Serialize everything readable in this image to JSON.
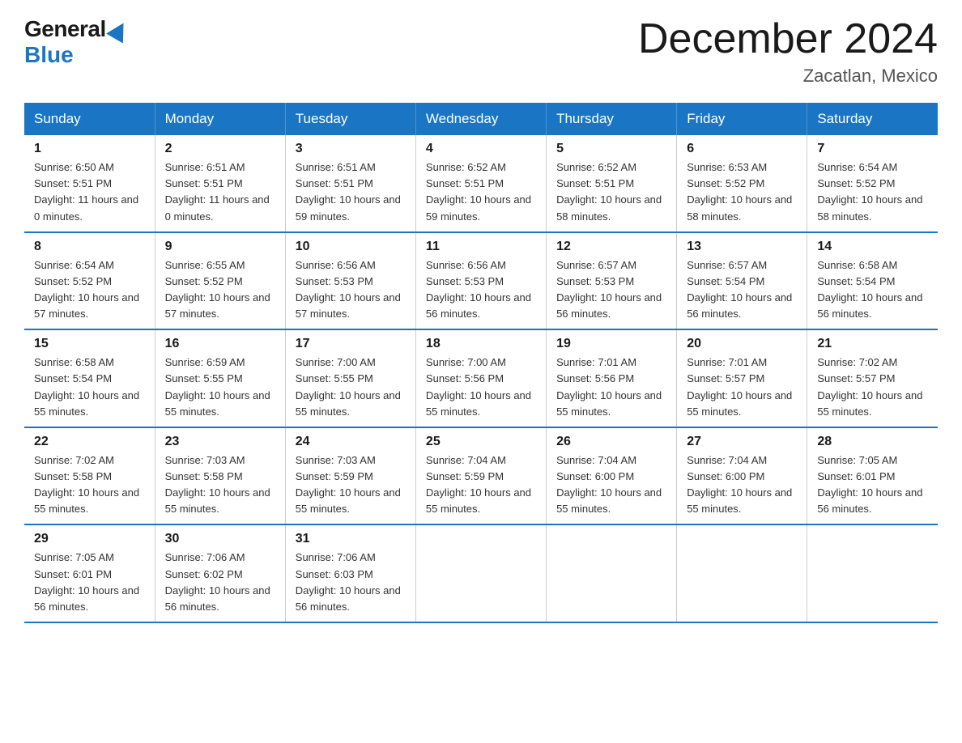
{
  "logo": {
    "general": "General",
    "blue": "Blue"
  },
  "title": "December 2024",
  "location": "Zacatlan, Mexico",
  "days_of_week": [
    "Sunday",
    "Monday",
    "Tuesday",
    "Wednesday",
    "Thursday",
    "Friday",
    "Saturday"
  ],
  "weeks": [
    [
      {
        "day": "1",
        "sunrise": "6:50 AM",
        "sunset": "5:51 PM",
        "daylight": "11 hours and 0 minutes."
      },
      {
        "day": "2",
        "sunrise": "6:51 AM",
        "sunset": "5:51 PM",
        "daylight": "11 hours and 0 minutes."
      },
      {
        "day": "3",
        "sunrise": "6:51 AM",
        "sunset": "5:51 PM",
        "daylight": "10 hours and 59 minutes."
      },
      {
        "day": "4",
        "sunrise": "6:52 AM",
        "sunset": "5:51 PM",
        "daylight": "10 hours and 59 minutes."
      },
      {
        "day": "5",
        "sunrise": "6:52 AM",
        "sunset": "5:51 PM",
        "daylight": "10 hours and 58 minutes."
      },
      {
        "day": "6",
        "sunrise": "6:53 AM",
        "sunset": "5:52 PM",
        "daylight": "10 hours and 58 minutes."
      },
      {
        "day": "7",
        "sunrise": "6:54 AM",
        "sunset": "5:52 PM",
        "daylight": "10 hours and 58 minutes."
      }
    ],
    [
      {
        "day": "8",
        "sunrise": "6:54 AM",
        "sunset": "5:52 PM",
        "daylight": "10 hours and 57 minutes."
      },
      {
        "day": "9",
        "sunrise": "6:55 AM",
        "sunset": "5:52 PM",
        "daylight": "10 hours and 57 minutes."
      },
      {
        "day": "10",
        "sunrise": "6:56 AM",
        "sunset": "5:53 PM",
        "daylight": "10 hours and 57 minutes."
      },
      {
        "day": "11",
        "sunrise": "6:56 AM",
        "sunset": "5:53 PM",
        "daylight": "10 hours and 56 minutes."
      },
      {
        "day": "12",
        "sunrise": "6:57 AM",
        "sunset": "5:53 PM",
        "daylight": "10 hours and 56 minutes."
      },
      {
        "day": "13",
        "sunrise": "6:57 AM",
        "sunset": "5:54 PM",
        "daylight": "10 hours and 56 minutes."
      },
      {
        "day": "14",
        "sunrise": "6:58 AM",
        "sunset": "5:54 PM",
        "daylight": "10 hours and 56 minutes."
      }
    ],
    [
      {
        "day": "15",
        "sunrise": "6:58 AM",
        "sunset": "5:54 PM",
        "daylight": "10 hours and 55 minutes."
      },
      {
        "day": "16",
        "sunrise": "6:59 AM",
        "sunset": "5:55 PM",
        "daylight": "10 hours and 55 minutes."
      },
      {
        "day": "17",
        "sunrise": "7:00 AM",
        "sunset": "5:55 PM",
        "daylight": "10 hours and 55 minutes."
      },
      {
        "day": "18",
        "sunrise": "7:00 AM",
        "sunset": "5:56 PM",
        "daylight": "10 hours and 55 minutes."
      },
      {
        "day": "19",
        "sunrise": "7:01 AM",
        "sunset": "5:56 PM",
        "daylight": "10 hours and 55 minutes."
      },
      {
        "day": "20",
        "sunrise": "7:01 AM",
        "sunset": "5:57 PM",
        "daylight": "10 hours and 55 minutes."
      },
      {
        "day": "21",
        "sunrise": "7:02 AM",
        "sunset": "5:57 PM",
        "daylight": "10 hours and 55 minutes."
      }
    ],
    [
      {
        "day": "22",
        "sunrise": "7:02 AM",
        "sunset": "5:58 PM",
        "daylight": "10 hours and 55 minutes."
      },
      {
        "day": "23",
        "sunrise": "7:03 AM",
        "sunset": "5:58 PM",
        "daylight": "10 hours and 55 minutes."
      },
      {
        "day": "24",
        "sunrise": "7:03 AM",
        "sunset": "5:59 PM",
        "daylight": "10 hours and 55 minutes."
      },
      {
        "day": "25",
        "sunrise": "7:04 AM",
        "sunset": "5:59 PM",
        "daylight": "10 hours and 55 minutes."
      },
      {
        "day": "26",
        "sunrise": "7:04 AM",
        "sunset": "6:00 PM",
        "daylight": "10 hours and 55 minutes."
      },
      {
        "day": "27",
        "sunrise": "7:04 AM",
        "sunset": "6:00 PM",
        "daylight": "10 hours and 55 minutes."
      },
      {
        "day": "28",
        "sunrise": "7:05 AM",
        "sunset": "6:01 PM",
        "daylight": "10 hours and 56 minutes."
      }
    ],
    [
      {
        "day": "29",
        "sunrise": "7:05 AM",
        "sunset": "6:01 PM",
        "daylight": "10 hours and 56 minutes."
      },
      {
        "day": "30",
        "sunrise": "7:06 AM",
        "sunset": "6:02 PM",
        "daylight": "10 hours and 56 minutes."
      },
      {
        "day": "31",
        "sunrise": "7:06 AM",
        "sunset": "6:03 PM",
        "daylight": "10 hours and 56 minutes."
      },
      null,
      null,
      null,
      null
    ]
  ]
}
